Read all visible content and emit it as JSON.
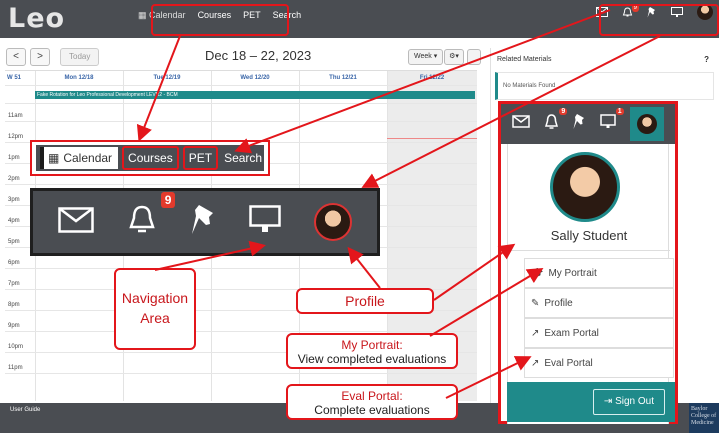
{
  "app": {
    "logo": "Leo"
  },
  "topnav": {
    "calendar": "Calendar",
    "courses": "Courses",
    "pet": "PET",
    "search": "Search"
  },
  "topicons": {
    "notif_count": "9"
  },
  "calendar": {
    "prev": "<",
    "next": ">",
    "today": "Today",
    "range": "Dec 18 – 22, 2023",
    "view": "Week ▾",
    "settings": "⚙▾",
    "week": "W 51",
    "days": [
      "Mon 12/18",
      "Tue 12/19",
      "Wed 12/20",
      "Thu 12/21",
      "Fri 12/22"
    ],
    "event": "Fake Rotation for Leo Professional Development LEVR2 - BCM",
    "times": [
      "11am",
      "12pm",
      "1pm",
      "2pm",
      "3pm",
      "4pm",
      "5pm",
      "6pm",
      "7pm",
      "8pm",
      "9pm",
      "10pm",
      "11pm"
    ]
  },
  "related": {
    "title": "Related Materials",
    "help": "?",
    "empty": "No Materials Found"
  },
  "bignav": {
    "calendar": "Calendar",
    "courses": "Courses",
    "pet": "PET",
    "search": "Search"
  },
  "bigicons": {
    "notif_count": "9"
  },
  "profile": {
    "notif_count": "9",
    "monitor_count": "1",
    "name": "Sally Student",
    "items": [
      "My Portrait",
      "Profile",
      "Exam Portal",
      "Eval Portal"
    ],
    "signout": "Sign Out"
  },
  "callouts": {
    "nav": "Navigation Area",
    "profile": "Profile",
    "portrait_title": "My Portrait:",
    "portrait_desc": "View completed evaluations",
    "eval_title": "Eval Portal:",
    "eval_desc": "Complete evaluations"
  },
  "footer": {
    "guide": "User Guide",
    "baylor": "Baylor College of Medicine"
  },
  "colors": {
    "bar": "#4a4d52",
    "teal": "#1f8a8a",
    "accent": "#e3161b",
    "badge": "#e23a2c"
  }
}
